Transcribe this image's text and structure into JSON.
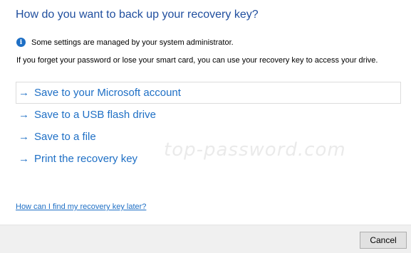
{
  "dialog": {
    "heading": "How do you want to back up your recovery key?",
    "notice": {
      "icon": "info-icon",
      "text": "Some settings are managed by your system administrator."
    },
    "explanation": "If you forget your password or lose your smart card, you can use your recovery key to access your drive.",
    "options": [
      {
        "arrow": "→",
        "label": "Save to your Microsoft account"
      },
      {
        "arrow": "→",
        "label": "Save to a USB flash drive"
      },
      {
        "arrow": "→",
        "label": "Save to a file"
      },
      {
        "arrow": "→",
        "label": "Print the recovery key"
      }
    ],
    "watermark": "top-password.com",
    "help_link": "How can I find my recovery key later?",
    "cancel_label": "Cancel"
  },
  "colors": {
    "heading": "#1f4e9e",
    "link": "#1e6fc5",
    "info_icon": "#1e6fc5",
    "footer_bg": "#f0f0f0"
  }
}
